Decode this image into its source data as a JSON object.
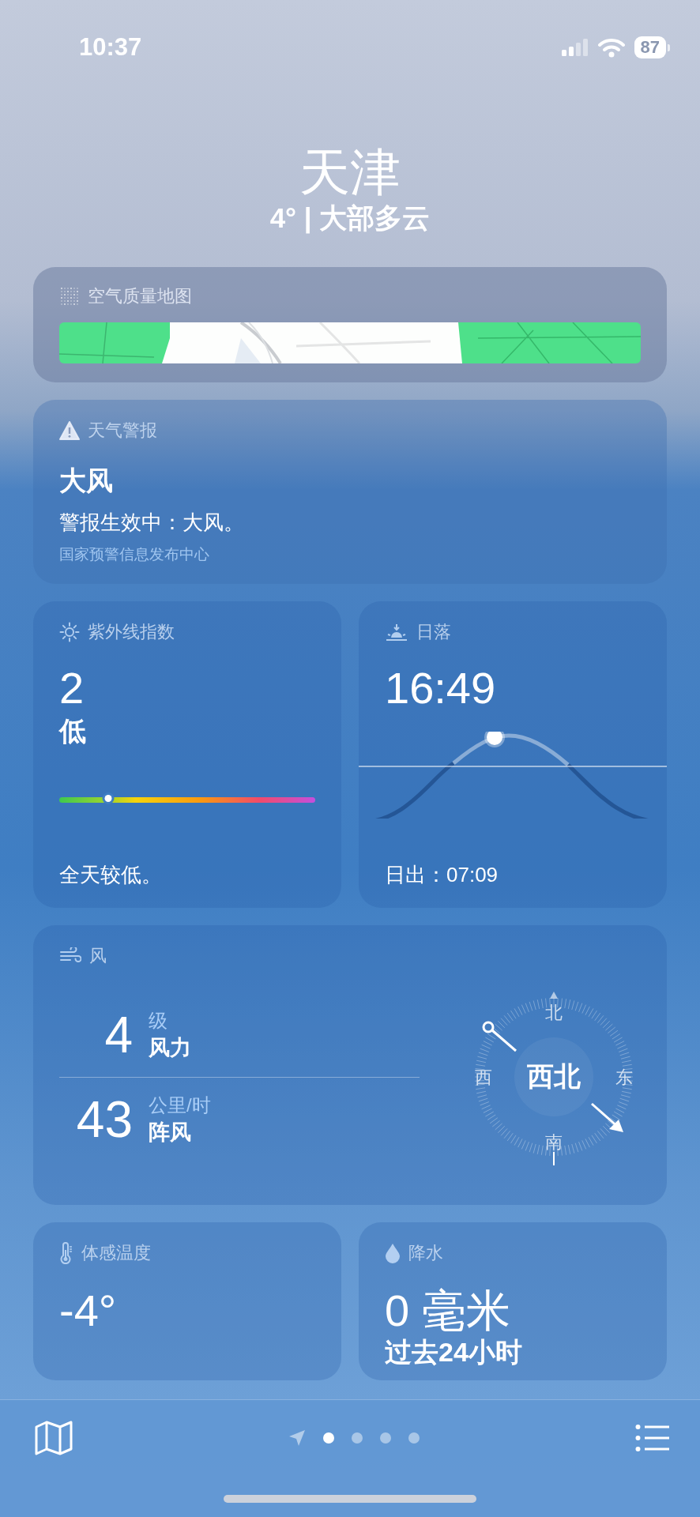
{
  "status_bar": {
    "time": "10:37",
    "battery": "87"
  },
  "header": {
    "city": "天津",
    "summary": "4° | 大部多云"
  },
  "air_quality_map": {
    "title": "空气质量地图"
  },
  "weather_alert": {
    "title": "天气警报",
    "headline": "大风",
    "description": "警报生效中：大风。",
    "source": "国家预警信息发布中心"
  },
  "uv_index": {
    "title": "紫外线指数",
    "value": "2",
    "category": "低",
    "level": 0.19,
    "note": "全天较低。"
  },
  "sunset": {
    "title": "日落",
    "time": "16:49",
    "sunrise": "日出：07:09"
  },
  "wind": {
    "title": "风",
    "force_value": "4",
    "force_unit": "级",
    "force_label": "风力",
    "gust_value": "43",
    "gust_unit": "公里/时",
    "gust_label": "阵风",
    "compass": {
      "north": "北",
      "east": "东",
      "south": "南",
      "west": "西",
      "direction": "西北"
    }
  },
  "feels_like": {
    "title": "体感温度",
    "value": "-4°"
  },
  "precipitation": {
    "title": "降水",
    "value": "0 毫米",
    "period": "过去24小时"
  },
  "page_dots": [
    {
      "selected": true
    },
    {
      "selected": false
    },
    {
      "selected": false
    },
    {
      "selected": false
    }
  ]
}
